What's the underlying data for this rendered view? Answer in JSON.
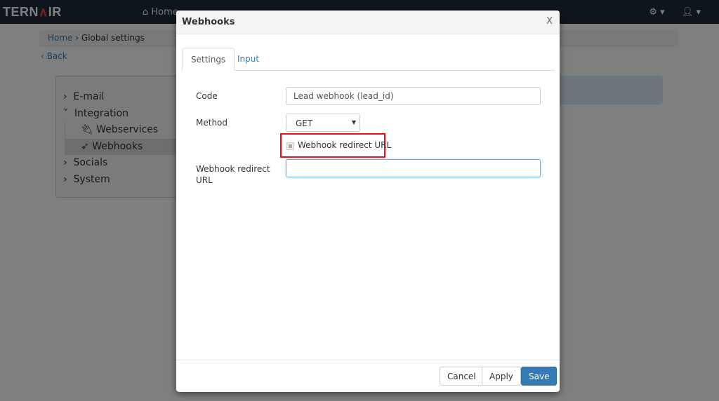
{
  "nav": {
    "logo": "TERNAIR",
    "home": "Home"
  },
  "breadcrumb": {
    "home": "Home",
    "sep": "›",
    "current": "Global settings"
  },
  "back": "‹ Back",
  "tree": [
    {
      "label": "E-mail",
      "arrow": "›"
    },
    {
      "label": "Integration",
      "arrow": "˅"
    },
    {
      "label": "Webservices",
      "icon": "plug-icon"
    },
    {
      "label": "Webhooks",
      "icon": "rocket-icon"
    },
    {
      "label": "Socials",
      "arrow": "›"
    },
    {
      "label": "System",
      "arrow": "›"
    }
  ],
  "modal": {
    "title": "Webhooks",
    "close": "X",
    "tabs": [
      "Settings",
      "Input"
    ],
    "code_label": "Code",
    "code_value": "Lead webhook (lead_id)",
    "method_label": "Method",
    "method_value": "GET",
    "checkbox_label": "Webhook redirect URL",
    "redirect_label": "Webhook redirect URL",
    "redirect_value": "",
    "cancel": "Cancel",
    "apply": "Apply",
    "save": "Save"
  },
  "colors": {
    "primary": "#337ab7",
    "highlight": "#e8101a",
    "navbar": "#1d2a38"
  }
}
